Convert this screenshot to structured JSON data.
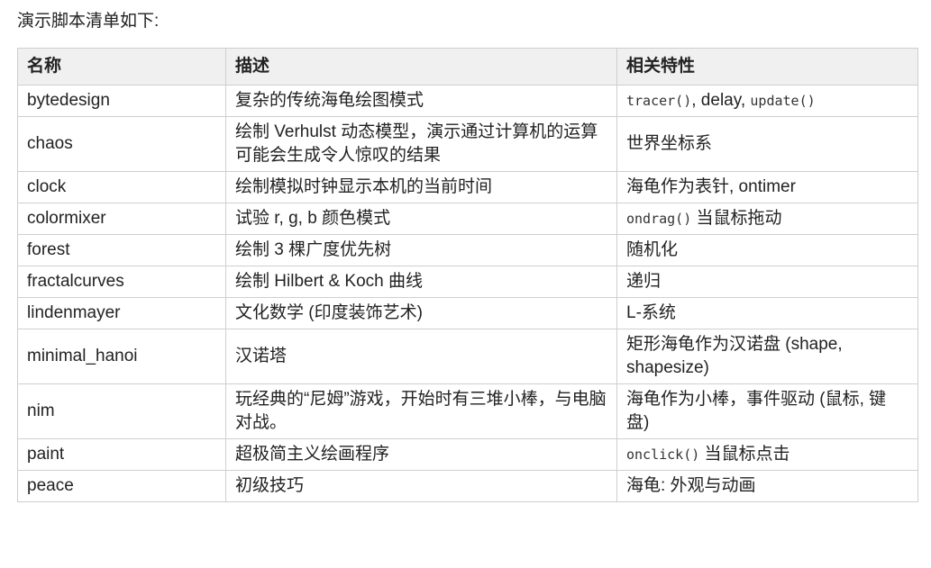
{
  "intro": "演示脚本清单如下:",
  "headers": [
    "名称",
    "描述",
    "相关特性"
  ],
  "rows": [
    {
      "name": "bytedesign",
      "desc": "复杂的传统海龟绘图模式",
      "feat": [
        {
          "t": "tracer()",
          "code": true
        },
        {
          "t": ", delay, ",
          "code": false
        },
        {
          "t": "update()",
          "code": true
        }
      ]
    },
    {
      "name": "chaos",
      "desc": "绘制 Verhulst 动态模型，演示通过计算机的运算可能会生成令人惊叹的结果",
      "feat": [
        {
          "t": "世界坐标系",
          "code": false
        }
      ]
    },
    {
      "name": "clock",
      "desc": "绘制模拟时钟显示本机的当前时间",
      "feat": [
        {
          "t": "海龟作为表针, ontimer",
          "code": false
        }
      ]
    },
    {
      "name": "colormixer",
      "desc": "试验 r, g, b 颜色模式",
      "feat": [
        {
          "t": "ondrag()",
          "code": true
        },
        {
          "t": " 当鼠标拖动",
          "code": false
        }
      ]
    },
    {
      "name": "forest",
      "desc": "绘制 3 棵广度优先树",
      "feat": [
        {
          "t": "随机化",
          "code": false
        }
      ]
    },
    {
      "name": "fractalcurves",
      "desc": "绘制 Hilbert & Koch 曲线",
      "feat": [
        {
          "t": "递归",
          "code": false
        }
      ]
    },
    {
      "name": "lindenmayer",
      "desc": "文化数学 (印度装饰艺术)",
      "feat": [
        {
          "t": "L-系统",
          "code": false
        }
      ]
    },
    {
      "name": "minimal_hanoi",
      "desc": "汉诺塔",
      "feat": [
        {
          "t": "矩形海龟作为汉诺盘 (shape, shapesize)",
          "code": false
        }
      ]
    },
    {
      "name": "nim",
      "desc": "玩经典的“尼姆”游戏，开始时有三堆小棒，与电脑对战。",
      "feat": [
        {
          "t": "海龟作为小棒，事件驱动 (鼠标, 键盘)",
          "code": false
        }
      ]
    },
    {
      "name": "paint",
      "desc": "超极简主义绘画程序",
      "feat": [
        {
          "t": "onclick()",
          "code": true
        },
        {
          "t": " 当鼠标点击",
          "code": false
        }
      ]
    },
    {
      "name": "peace",
      "desc": "初级技巧",
      "feat": [
        {
          "t": "海龟: 外观与动画",
          "code": false
        }
      ]
    }
  ]
}
